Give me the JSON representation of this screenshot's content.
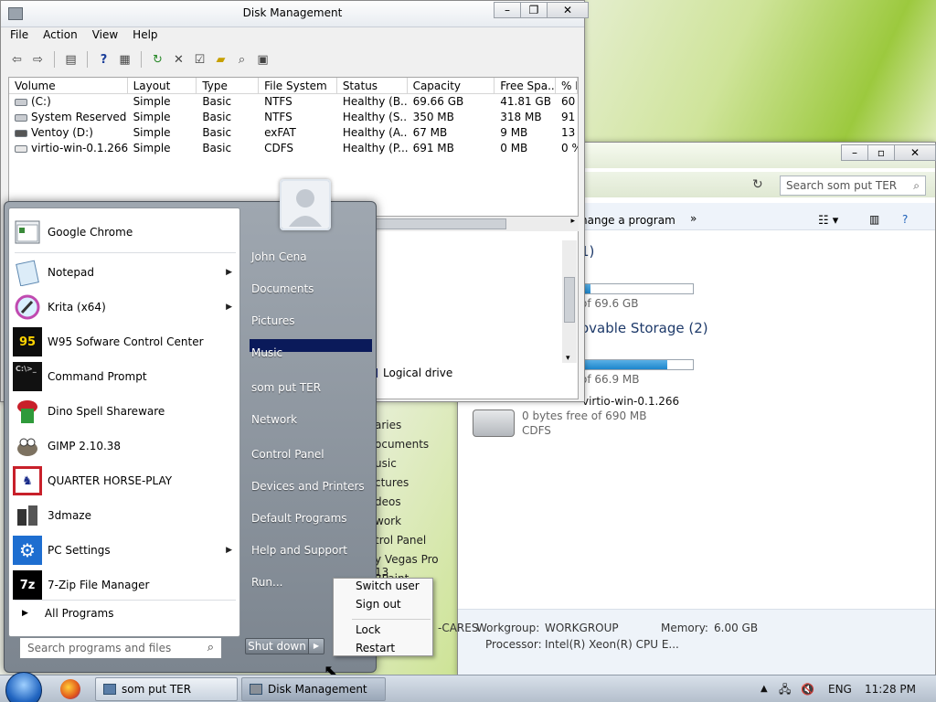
{
  "disk_mgmt": {
    "title": "Disk Management",
    "menu": [
      "File",
      "Action",
      "View",
      "Help"
    ],
    "columns": [
      "Volume",
      "Layout",
      "Type",
      "File System",
      "Status",
      "Capacity",
      "Free Spa...",
      "% F"
    ],
    "rows": [
      [
        "(C:)",
        "Simple",
        "Basic",
        "NTFS",
        "Healthy (B...",
        "69.66 GB",
        "41.81 GB",
        "60"
      ],
      [
        "System Reserved",
        "Simple",
        "Basic",
        "NTFS",
        "Healthy (S...",
        "350 MB",
        "318 MB",
        "91"
      ],
      [
        "Ventoy (D:)",
        "Simple",
        "Basic",
        "exFAT",
        "Healthy (A...",
        "67 MB",
        "9 MB",
        "13"
      ],
      [
        "virtio-win-0.1.266 ...",
        "Simple",
        "Basic",
        "CDFS",
        "Healthy (P...",
        "691 MB",
        "0 MB",
        "0 %"
      ]
    ],
    "legend": "Logical drive"
  },
  "explorer": {
    "search_placeholder": "Search som put TER",
    "cmd_change": "hange a program",
    "cmd_more": "»",
    "section1_count": "1)",
    "drive1_sub_a": ")",
    "drive1_free": "of 69.6 GB",
    "section2": "ovable Storage (2)",
    "drive2_free": "of 66.9 MB",
    "cd_name": "virtio-win-0.1.266",
    "cd_free": "0 bytes free of 690 MB",
    "cd_fs": "CDFS",
    "nav": [
      "aries",
      "ocuments",
      "usic",
      "ctures",
      "deos",
      "work",
      "trol Panel",
      "y Vegas Pro 13",
      "2Paint 2.20_DP"
    ],
    "pc_suffix": "-CARES",
    "workgroup_label": "Workgroup:",
    "workgroup": "WORKGROUP",
    "memory_label": "Memory:",
    "memory": "6.00 GB",
    "processor_label": "Processor:",
    "processor": "Intel(R) Xeon(R) CPU E..."
  },
  "start_menu": {
    "programs": [
      {
        "label": "Google Chrome",
        "submenu": false
      },
      {
        "label": "Notepad",
        "submenu": true
      },
      {
        "label": "Krita (x64)",
        "submenu": true
      },
      {
        "label": "W95 Sofware Control Center",
        "submenu": false
      },
      {
        "label": "Command Prompt",
        "submenu": false
      },
      {
        "label": "Dino Spell Shareware",
        "submenu": false
      },
      {
        "label": "GIMP 2.10.38",
        "submenu": false
      },
      {
        "label": "QUARTER  HORSE-PLAY",
        "submenu": false
      },
      {
        "label": "3dmaze",
        "submenu": false
      },
      {
        "label": "PC Settings",
        "submenu": true
      },
      {
        "label": "7-Zip File Manager",
        "submenu": false
      }
    ],
    "all_programs": "All Programs",
    "search_placeholder": "Search programs and files",
    "right_items": [
      "John Cena",
      "Documents",
      "Pictures",
      "Music",
      "som put TER",
      "Network",
      "Control Panel",
      "Devices and Printers",
      "Default Programs",
      "Help and Support",
      "Run..."
    ],
    "selected_right": "Music",
    "shutdown_label": "Shut down"
  },
  "context_menu": {
    "items": [
      "Switch user",
      "Sign out",
      "Lock",
      "Restart"
    ]
  },
  "taskbar": {
    "buttons": [
      {
        "label": "som put TER",
        "active": false
      },
      {
        "label": "Disk Management",
        "active": true
      }
    ],
    "language": "ENG",
    "clock": "11:28 PM"
  }
}
